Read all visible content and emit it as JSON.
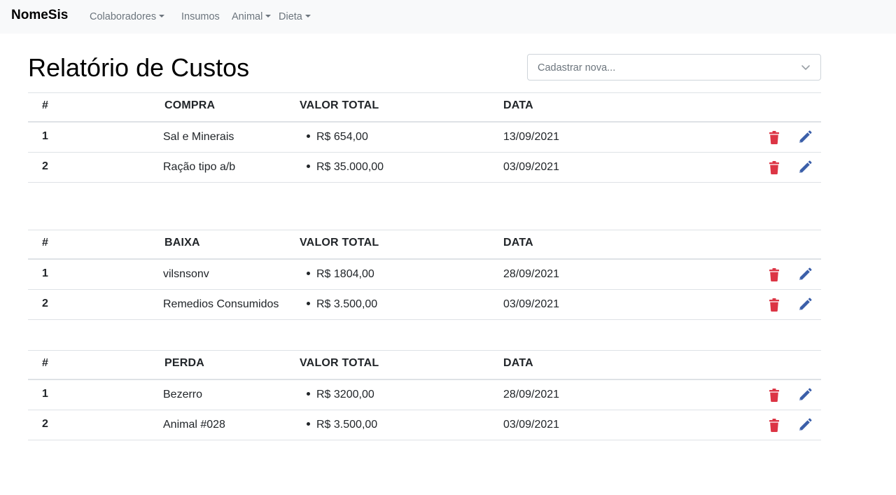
{
  "navbar": {
    "brand": "NomeSis",
    "items": [
      {
        "label": "Colaboradores",
        "dropdown": true
      },
      {
        "label": "Insumos",
        "dropdown": false
      },
      {
        "label": "Animal",
        "dropdown": true
      },
      {
        "label": "Dieta",
        "dropdown": true
      }
    ]
  },
  "page": {
    "title": "Relatório de Custos",
    "select_placeholder": "Cadastrar nova..."
  },
  "colors": {
    "delete": "#dc3545",
    "edit": "#3b5fa9",
    "navbar_bg": "#f8f9fa"
  },
  "icons": {
    "delete": "trash-icon",
    "edit": "pencil-icon",
    "select": "chevron-down-icon"
  },
  "tables": [
    {
      "headers": [
        "#",
        "COMPRA",
        "VALOR TOTAL",
        "DATA"
      ],
      "rows": [
        {
          "num": "1",
          "name": "Sal e Minerais",
          "value": "R$ 654,00",
          "date": "13/09/2021"
        },
        {
          "num": "2",
          "name": "Ração tipo a/b",
          "value": "R$ 35.000,00",
          "date": "03/09/2021"
        }
      ]
    },
    {
      "headers": [
        "#",
        "BAIXA",
        "VALOR TOTAL",
        "DATA"
      ],
      "rows": [
        {
          "num": "1",
          "name": "vilsnsonv",
          "value": "R$ 1804,00",
          "date": "28/09/2021"
        },
        {
          "num": "2",
          "name": "Remedios Consumidos",
          "value": "R$ 3.500,00",
          "date": "03/09/2021"
        }
      ]
    },
    {
      "headers": [
        "#",
        "PERDA",
        "VALOR TOTAL",
        "DATA"
      ],
      "rows": [
        {
          "num": "1",
          "name": "Bezerro",
          "value": "R$ 3200,00",
          "date": "28/09/2021"
        },
        {
          "num": "2",
          "name": "Animal #028",
          "value": "R$ 3.500,00",
          "date": "03/09/2021"
        }
      ]
    }
  ]
}
